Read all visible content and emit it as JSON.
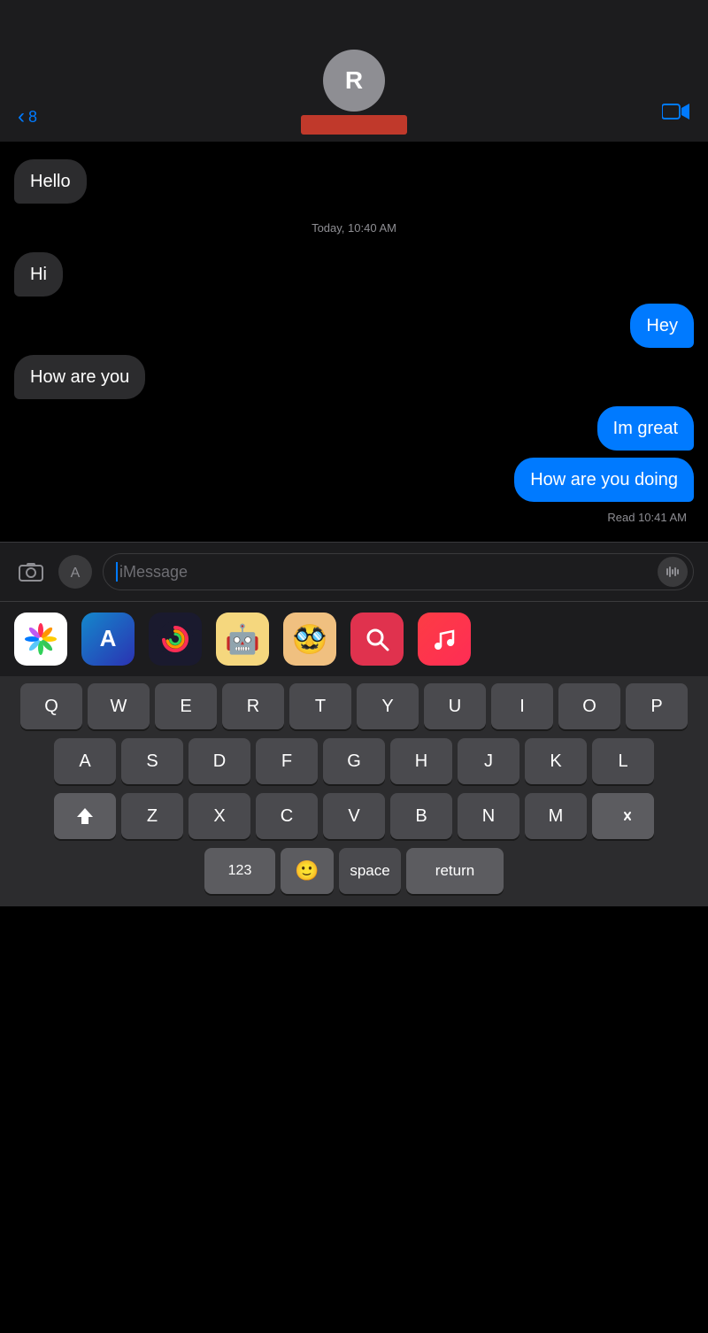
{
  "header": {
    "back_label": "8",
    "contact_initial": "R",
    "video_icon": "📹"
  },
  "messages": [
    {
      "id": 1,
      "type": "received",
      "text": "Hello"
    },
    {
      "id": 2,
      "timestamp": "Today, 10:40 AM"
    },
    {
      "id": 3,
      "type": "received",
      "text": "Hi"
    },
    {
      "id": 4,
      "type": "sent",
      "text": "Hey"
    },
    {
      "id": 5,
      "type": "received",
      "text": "How are you"
    },
    {
      "id": 6,
      "type": "sent",
      "text": "Im great"
    },
    {
      "id": 7,
      "type": "sent",
      "text": "How are you doing"
    }
  ],
  "read_receipt": "Read 10:41 AM",
  "input": {
    "placeholder": "iMessage"
  },
  "app_icons": [
    {
      "id": "photos",
      "emoji": "🌸",
      "bg": "#fff"
    },
    {
      "id": "appstore",
      "emoji": "🅰",
      "bg": "#1a78f0"
    },
    {
      "id": "activity",
      "emoji": "🌀",
      "bg": "#1a1a2e"
    },
    {
      "id": "memoji1",
      "emoji": "🤖",
      "bg": "#f5d77e"
    },
    {
      "id": "memoji2",
      "emoji": "🥸",
      "bg": "#f0c080"
    },
    {
      "id": "websearch",
      "emoji": "🔍",
      "bg": "#e0324e"
    },
    {
      "id": "music",
      "emoji": "🎵",
      "bg": "#e0324e"
    }
  ],
  "keyboard": {
    "rows": [
      [
        "Q",
        "W",
        "E",
        "R",
        "T",
        "Y",
        "U",
        "I",
        "O",
        "P"
      ],
      [
        "A",
        "S",
        "D",
        "F",
        "G",
        "H",
        "J",
        "K",
        "L"
      ],
      [
        "Z",
        "X",
        "C",
        "V",
        "B",
        "N",
        "M"
      ]
    ],
    "space_label": "space",
    "return_label": "return",
    "num_label": "123"
  }
}
